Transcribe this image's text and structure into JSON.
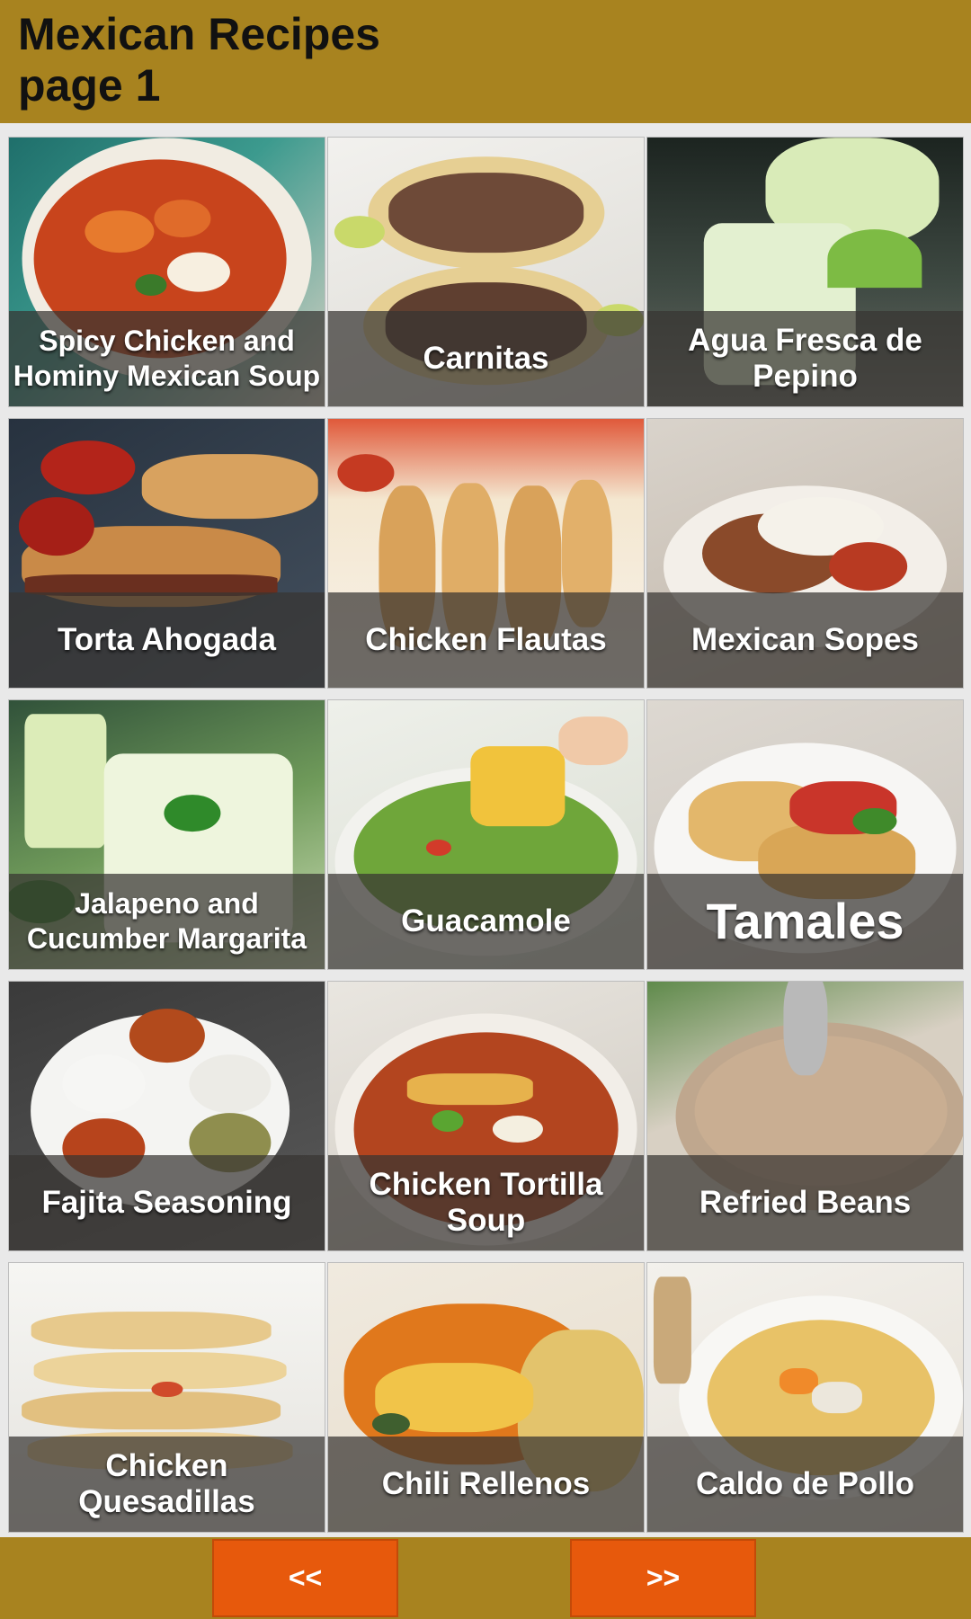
{
  "header": {
    "title": "Mexican Recipes\npage 1"
  },
  "recipes": [
    {
      "name": "Spicy Chicken and\nHominy Mexican Soup",
      "style": "small",
      "photo": "soup"
    },
    {
      "name": "Carnitas",
      "style": "normal",
      "photo": "tacos"
    },
    {
      "name": "Agua Fresca de\nPepino",
      "style": "normal",
      "photo": "drink"
    },
    {
      "name": "Torta Ahogada",
      "style": "normal",
      "photo": "sandwich"
    },
    {
      "name": "Chicken Flautas",
      "style": "normal",
      "photo": "flautas"
    },
    {
      "name": "Mexican Sopes",
      "style": "normal",
      "photo": "sopes"
    },
    {
      "name": "Jalapeno and\nCucumber Margarita",
      "style": "small",
      "photo": "margarita"
    },
    {
      "name": "Guacamole",
      "style": "normal",
      "photo": "guacamole"
    },
    {
      "name": "Tamales",
      "style": "big",
      "photo": "tamales"
    },
    {
      "name": "Fajita Seasoning",
      "style": "normal",
      "photo": "spices"
    },
    {
      "name": "Chicken Tortilla\nSoup",
      "style": "normal",
      "photo": "tortillasoup"
    },
    {
      "name": "Refried Beans",
      "style": "normal",
      "photo": "beans"
    },
    {
      "name": "Chicken\nQuesadillas",
      "style": "normal",
      "photo": "quesadillas"
    },
    {
      "name": "Chili Rellenos",
      "style": "normal",
      "photo": "rellenos"
    },
    {
      "name": "Caldo de Pollo",
      "style": "normal",
      "photo": "caldo"
    }
  ],
  "footer": {
    "prev_label": "<<",
    "next_label": ">>"
  },
  "colors": {
    "header_bg": "#a8831f",
    "button_bg": "#e7590c"
  }
}
